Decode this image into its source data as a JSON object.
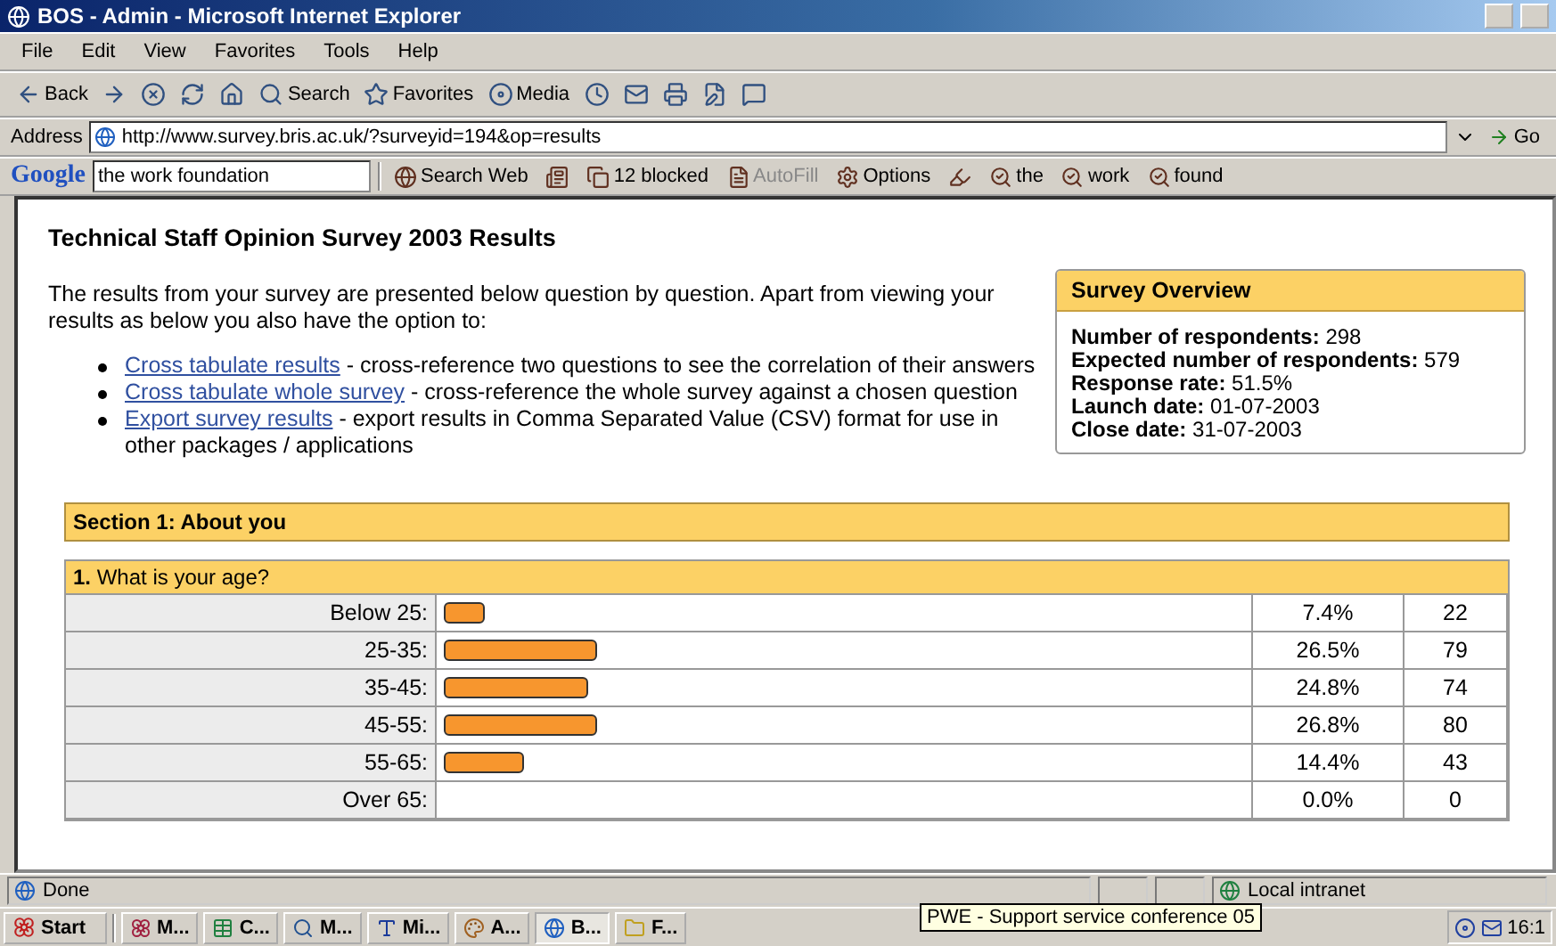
{
  "window": {
    "title": "BOS - Admin - Microsoft Internet Explorer"
  },
  "menu": [
    "File",
    "Edit",
    "View",
    "Favorites",
    "Tools",
    "Help"
  ],
  "toolbar": [
    {
      "kind": "back",
      "label": "Back"
    },
    {
      "kind": "forward"
    },
    {
      "kind": "stop"
    },
    {
      "kind": "refresh"
    },
    {
      "kind": "home"
    },
    {
      "kind": "search",
      "label": "Search"
    },
    {
      "kind": "favorites",
      "label": "Favorites"
    },
    {
      "kind": "media",
      "label": "Media"
    },
    {
      "kind": "history"
    },
    {
      "kind": "mail"
    },
    {
      "kind": "print"
    },
    {
      "kind": "edit"
    },
    {
      "kind": "discuss"
    }
  ],
  "address": {
    "label": "Address",
    "value": "http://www.survey.bris.ac.uk/?surveyid=194&op=results",
    "go": "Go"
  },
  "google_bar": {
    "logo": "Google",
    "query": "the work foundation",
    "buttons": [
      {
        "kind": "search",
        "label": "Search Web"
      },
      {
        "kind": "news"
      },
      {
        "kind": "popup",
        "label": "12 blocked"
      },
      {
        "kind": "autofill",
        "label": "AutoFill",
        "disabled": true
      },
      {
        "kind": "options",
        "label": "Options"
      },
      {
        "kind": "highlight"
      },
      {
        "kind": "term",
        "label": "the"
      },
      {
        "kind": "term",
        "label": "work"
      },
      {
        "kind": "term",
        "label": "found"
      }
    ]
  },
  "page": {
    "heading": "Technical Staff Opinion Survey 2003 Results",
    "intro": "The results from your survey are presented below question by question. Apart from viewing your results as below you also have the option to:",
    "options": [
      {
        "link": "Cross tabulate results",
        "text": " - cross-reference two questions to see the correlation of their answers"
      },
      {
        "link": "Cross tabulate whole survey",
        "text": " - cross-reference the whole survey against a chosen question"
      },
      {
        "link": "Export survey results",
        "text": " - export results in Comma Separated Value (CSV) format for use in other packages / applications"
      }
    ],
    "overview": {
      "title": "Survey Overview",
      "items": [
        {
          "label": "Number of respondents:",
          "value": "298"
        },
        {
          "label": "Expected number of respondents:",
          "value": "579"
        },
        {
          "label": "Response rate:",
          "value": "51.5%"
        },
        {
          "label": "Launch date:",
          "value": "01-07-2003"
        },
        {
          "label": "Close date:",
          "value": "31-07-2003"
        }
      ]
    },
    "section": {
      "title": "Section 1: About you"
    },
    "question": {
      "number": "1.",
      "text": "What is your age?",
      "rows": [
        {
          "label": "Below 25:",
          "level": 0.05,
          "percent": "7.4%",
          "count": "22"
        },
        {
          "label": "25-35:",
          "level": 0.19,
          "percent": "26.5%",
          "count": "79"
        },
        {
          "label": "35-45:",
          "level": 0.18,
          "percent": "24.8%",
          "count": "74"
        },
        {
          "label": "45-55:",
          "level": 0.19,
          "percent": "26.8%",
          "count": "80"
        },
        {
          "label": "55-65:",
          "level": 0.1,
          "percent": "14.4%",
          "count": "43"
        },
        {
          "label": "Over 65:",
          "percent": "0.0%",
          "count": "0"
        }
      ]
    }
  },
  "status_bar": {
    "text": "Done",
    "zone": "Local intranet"
  },
  "taskbar": {
    "start": "Start",
    "items": [
      {
        "kind": "flower",
        "label": "M...",
        "selected": false
      },
      {
        "kind": "sheet",
        "label": "C...",
        "selected": false
      },
      {
        "kind": "find",
        "label": "M...",
        "selected": false
      },
      {
        "kind": "word",
        "label": "Mi...",
        "selected": false
      },
      {
        "kind": "paint",
        "label": "A...",
        "selected": false
      },
      {
        "kind": "ie",
        "label": "B...",
        "selected": true
      },
      {
        "kind": "folder",
        "label": "F...",
        "selected": false
      }
    ],
    "tooltip": "PWE - Support service conference 05",
    "clock": "16:1"
  }
}
